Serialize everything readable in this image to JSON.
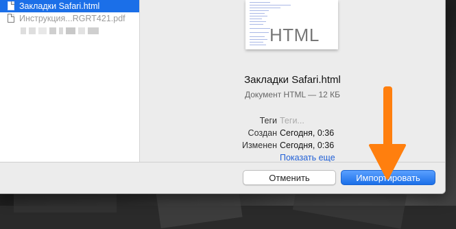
{
  "files": [
    {
      "label": "Закладки Safari.html",
      "selected": true,
      "icon": "html-document-icon"
    },
    {
      "label": "Инструкция...RGRT421.pdf",
      "selected": false,
      "icon": "pdf-document-icon"
    }
  ],
  "preview": {
    "thumbnail_text": "HTML",
    "title": "Закладки Safari.html",
    "kind": "Документ HTML — 12 КБ",
    "meta": {
      "tags_label": "Теги",
      "tags_placeholder": "Теги...",
      "created_label": "Создан",
      "created_value": "Сегодня, 0:36",
      "modified_label": "Изменен",
      "modified_value": "Сегодня, 0:36"
    },
    "show_more": "Показать еще"
  },
  "buttons": {
    "cancel": "Отменить",
    "import": "Импортировать"
  },
  "colors": {
    "selection": "#1b6fe8",
    "link": "#2160d6",
    "annotation_arrow": "#ff7f0e"
  }
}
